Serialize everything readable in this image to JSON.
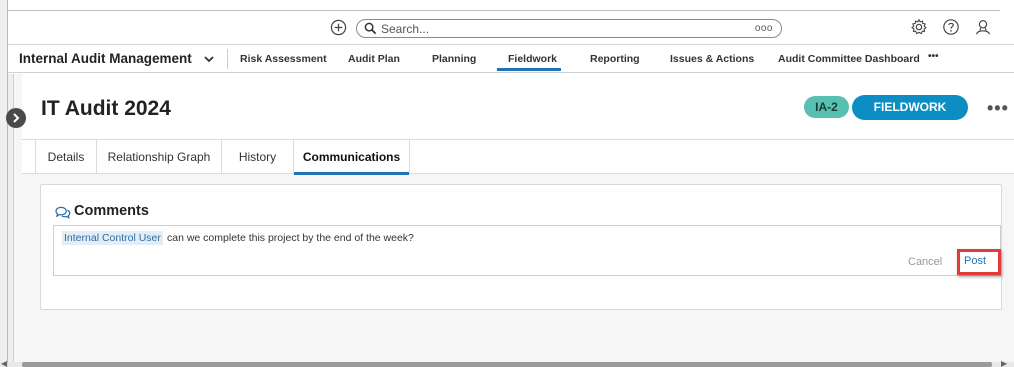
{
  "search": {
    "placeholder": "Search...",
    "options_glyph": "ooo"
  },
  "topbar": {
    "icons": [
      "plus-circle-icon",
      "gear-icon",
      "help-icon",
      "user-icon"
    ]
  },
  "nav": {
    "app_title": "Internal Audit Management",
    "items": [
      {
        "label": "Risk Assessment"
      },
      {
        "label": "Audit Plan"
      },
      {
        "label": "Planning"
      },
      {
        "label": "Fieldwork",
        "active": true
      },
      {
        "label": "Reporting"
      },
      {
        "label": "Issues & Actions"
      },
      {
        "label": "Audit Committee Dashboard"
      }
    ],
    "more": "•••"
  },
  "record": {
    "title": "IT Audit 2024",
    "id_badge": "IA-2",
    "status": "FIELDWORK",
    "more": "•••"
  },
  "tabs": [
    {
      "label": "Details"
    },
    {
      "label": "Relationship Graph"
    },
    {
      "label": "History"
    },
    {
      "label": "Communications",
      "active": true
    }
  ],
  "comments": {
    "title": "Comments",
    "mention": "Internal Control  User",
    "text": "can we complete this project by the end of the week?",
    "cancel_label": "Cancel",
    "post_label": "Post"
  },
  "colors": {
    "accent": "#1f73b7",
    "status_pill": "#0c8ec4",
    "id_badge": "#57c0b2",
    "highlight_box": "#e03b3b"
  }
}
